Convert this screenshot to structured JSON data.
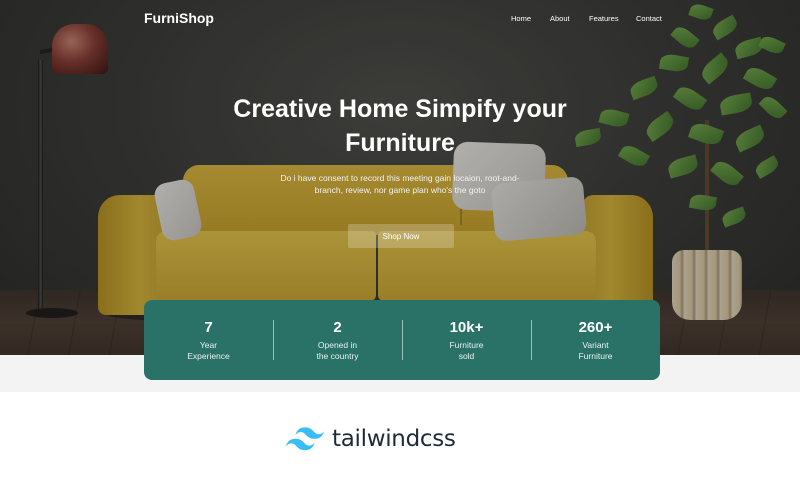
{
  "brand": {
    "name": "FurniShop"
  },
  "nav": {
    "items": [
      {
        "label": "Home"
      },
      {
        "label": "About"
      },
      {
        "label": "Features"
      },
      {
        "label": "Contact"
      }
    ]
  },
  "hero": {
    "headline_line1": "Creative Home Simpify your",
    "headline_line2": "Furniture",
    "subtext": "Do i have consent to record this meeting gain locaion, root-and-branch, review, nor game plan who's the goto",
    "cta_label": "Shop Now"
  },
  "stats": [
    {
      "value": "7",
      "label_line1": "Year",
      "label_line2": "Experience"
    },
    {
      "value": "2",
      "label_line1": "Opened in",
      "label_line2": "the country"
    },
    {
      "value": "10k+",
      "label_line1": "Furniture",
      "label_line2": "sold"
    },
    {
      "value": "260+",
      "label_line1": "Variant",
      "label_line2": "Furniture"
    }
  ],
  "footer_logo": {
    "text": "tailwindcss",
    "icon": "tailwind-logo-icon"
  },
  "colors": {
    "accent": "#2a7268",
    "logo_mark": "#38bdf8",
    "logo_text": "#1f2a37"
  }
}
